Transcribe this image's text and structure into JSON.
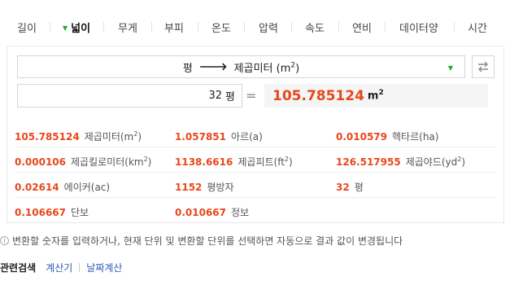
{
  "tabs": [
    {
      "label": "길이",
      "active": false
    },
    {
      "label": "넓이",
      "active": true
    },
    {
      "label": "무게",
      "active": false
    },
    {
      "label": "부피",
      "active": false
    },
    {
      "label": "온도",
      "active": false
    },
    {
      "label": "압력",
      "active": false
    },
    {
      "label": "속도",
      "active": false
    },
    {
      "label": "연비",
      "active": false
    },
    {
      "label": "데이터양",
      "active": false
    },
    {
      "label": "시간",
      "active": false
    }
  ],
  "converter": {
    "from_unit": "평",
    "to_unit_name": "제곱미터 (m",
    "to_unit_sup": "2",
    "to_unit_close": ")",
    "input_value": "32",
    "input_unit": "평",
    "equals": "=",
    "result_value": "105.785124",
    "result_unit_base": "m",
    "result_unit_sup": "2"
  },
  "results": [
    {
      "value": "105.785124",
      "label": "제곱미터(m",
      "sup": "2",
      "close": ")"
    },
    {
      "value": "1.057851",
      "label": "아르(a)",
      "sup": "",
      "close": ""
    },
    {
      "value": "0.010579",
      "label": "헥타르(ha)",
      "sup": "",
      "close": ""
    },
    {
      "value": "0.000106",
      "label": "제곱킬로미터(km",
      "sup": "2",
      "close": ")"
    },
    {
      "value": "1138.6616",
      "label": "제곱피트(ft",
      "sup": "2",
      "close": ")"
    },
    {
      "value": "126.517955",
      "label": "제곱야드(yd",
      "sup": "2",
      "close": ")"
    },
    {
      "value": "0.02614",
      "label": "에이커(ac)",
      "sup": "",
      "close": ""
    },
    {
      "value": "1152",
      "label": "평방자",
      "sup": "",
      "close": ""
    },
    {
      "value": "32",
      "label": "평",
      "sup": "",
      "close": ""
    },
    {
      "value": "0.106667",
      "label": "단보",
      "sup": "",
      "close": ""
    },
    {
      "value": "0.010667",
      "label": "정보",
      "sup": "",
      "close": ""
    }
  ],
  "help_text": "변환할 숫자를 입력하거나, 현재 단위 및 변환할 단위를 선택하면 자동으로 결과 값이 변경됩니다",
  "related": {
    "title": "관련검색",
    "links": [
      "계산기",
      "날짜계산"
    ]
  },
  "colors": {
    "accent_orange": "#e8471c",
    "accent_green": "#1aad1a",
    "link_blue": "#2f5bb7"
  },
  "icons": {
    "swap": "swap-arrows-icon",
    "info": "info-icon",
    "dropdown": "dropdown-caret-icon"
  }
}
